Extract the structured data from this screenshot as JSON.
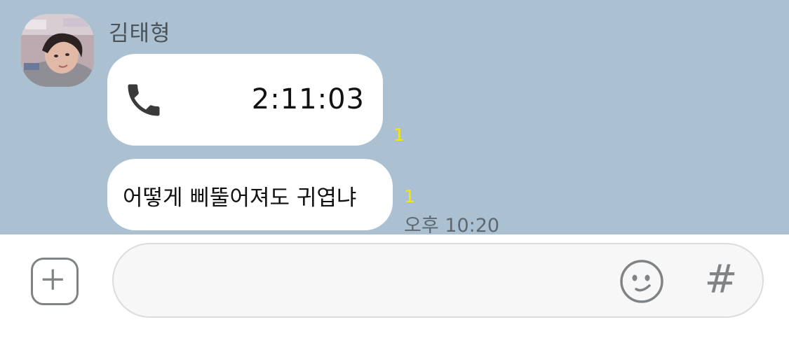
{
  "chat": {
    "sender_name": "김태형",
    "messages": [
      {
        "type": "call",
        "duration": "2:11:03",
        "icon": "phone-icon",
        "unread": "1"
      },
      {
        "type": "text",
        "text": "어떻게 삐뚤어져도 귀엽냐",
        "unread": "1",
        "time": "오후 10:20"
      }
    ]
  },
  "input_bar": {
    "placeholder": "",
    "add_icon": "plus-icon",
    "emoji_icon": "smiley-icon",
    "hash_label": "#"
  },
  "colors": {
    "chat_background": "#abc1d2",
    "bubble": "#ffffff",
    "unread_count": "#f7e600",
    "icon_gray": "#7f8385"
  }
}
